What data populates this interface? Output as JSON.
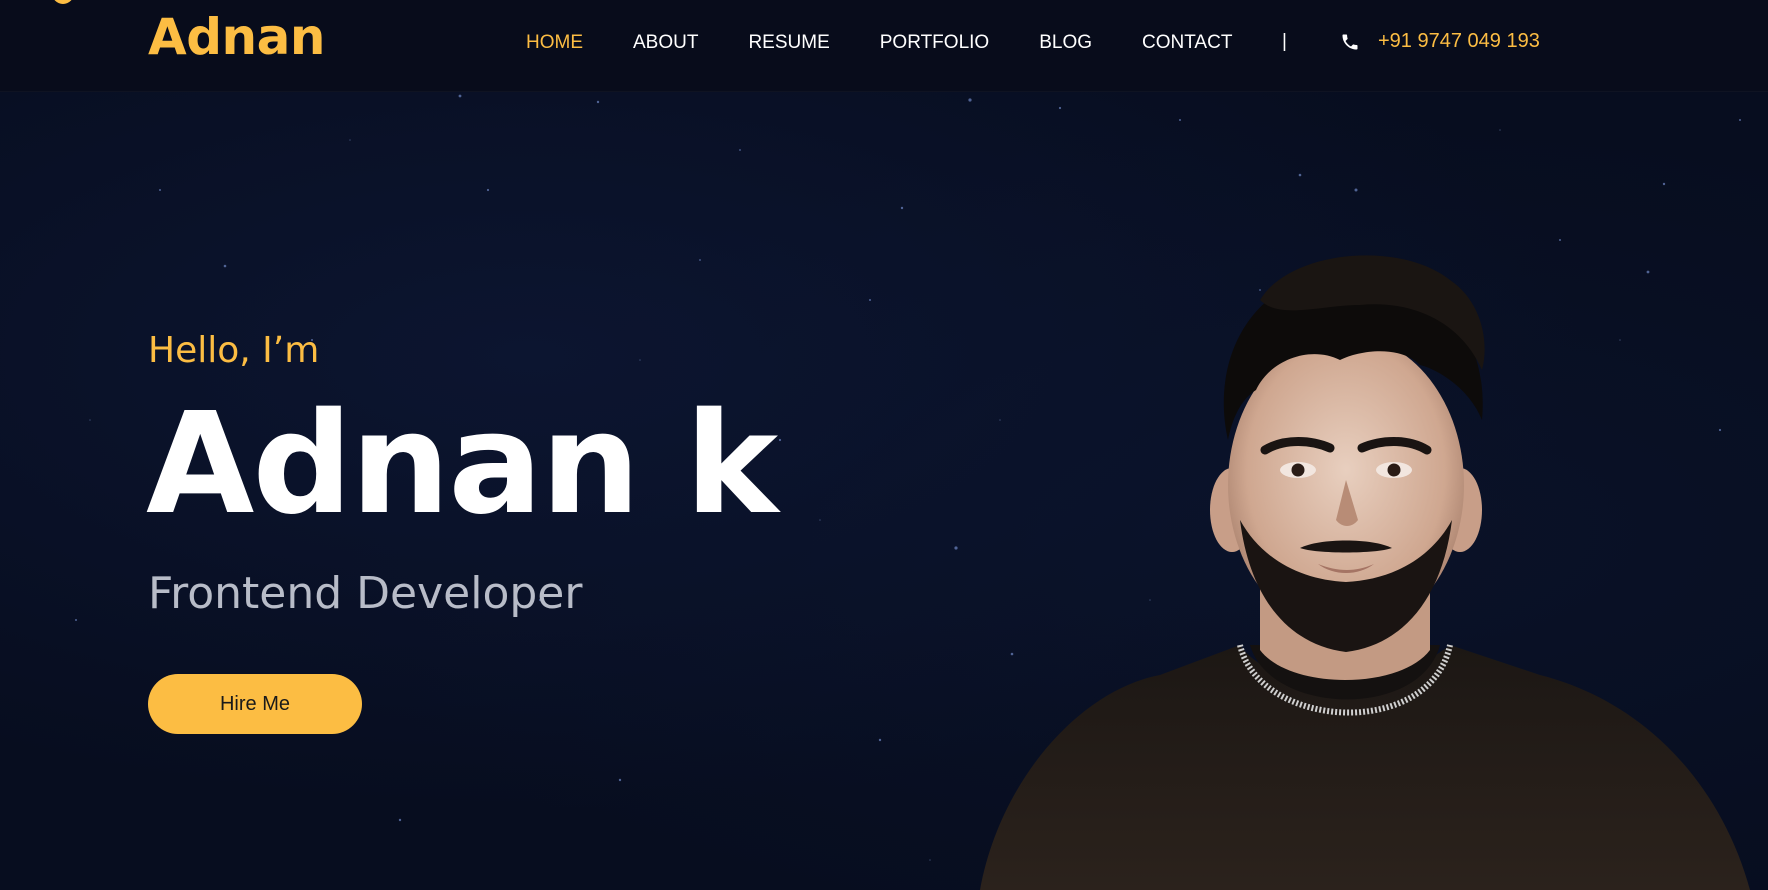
{
  "header": {
    "logo": "Adnan",
    "nav": [
      {
        "label": "HOME",
        "active": true
      },
      {
        "label": "ABOUT",
        "active": false
      },
      {
        "label": "RESUME",
        "active": false
      },
      {
        "label": "PORTFOLIO",
        "active": false
      },
      {
        "label": "BLOG",
        "active": false
      },
      {
        "label": "CONTACT",
        "active": false
      }
    ],
    "separator": "|",
    "phone_icon": "phone-icon",
    "phone": "+91 9747 049 193"
  },
  "hero": {
    "greeting": "Hello, I’m",
    "name": "Adnan k",
    "role": "Frontend Developer",
    "cta_label": "Hire Me"
  },
  "colors": {
    "accent": "#fcbd43",
    "background": "#070d1f",
    "header_background": "#080c1b",
    "text": "#ffffff",
    "muted_text": "#b8bcc8"
  }
}
